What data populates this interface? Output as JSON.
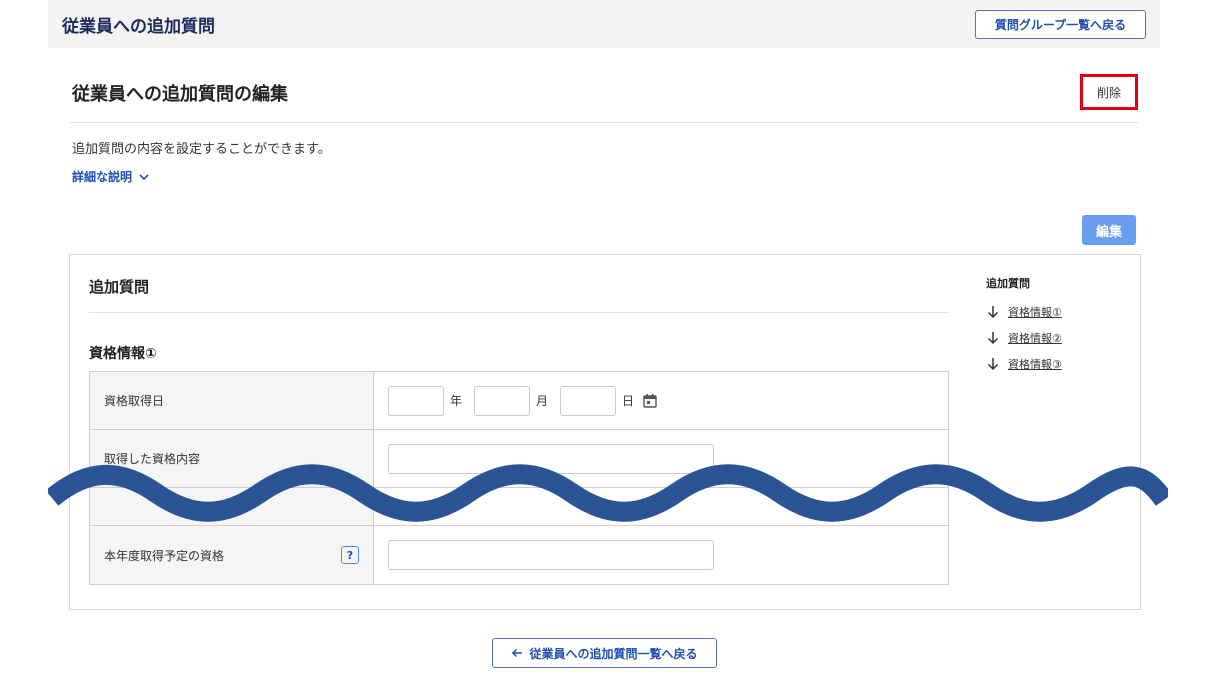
{
  "header": {
    "title": "従業員への追加質問",
    "back_groups_label": "質問グループ一覧へ戻る"
  },
  "page": {
    "title": "従業員への追加質問の編集",
    "delete_label": "削除",
    "description": "追加質問の内容を設定することができます。",
    "details_label": "詳細な説明",
    "edit_label": "編集"
  },
  "card": {
    "title": "追加質問",
    "section_title": "資格情報①",
    "rows": {
      "acquired_date_label": "資格取得日",
      "year_unit": "年",
      "month_unit": "月",
      "day_unit": "日",
      "acquired_content_label": "取得した資格内容",
      "planned_label": "本年度取得予定の資格",
      "help_glyph": "?"
    }
  },
  "toc": {
    "title": "追加質問",
    "items": [
      "資格情報①",
      "資格情報②",
      "資格情報③"
    ]
  },
  "footer": {
    "back_list_label": "従業員への追加質問一覧へ戻る"
  },
  "colors": {
    "accent": "#1f4fb0",
    "delete_highlight": "#e0000c",
    "wave": "#2b5494",
    "edit_button": "#6a9ded"
  },
  "icons": {
    "details": "chevron-down-icon",
    "calendar": "calendar-icon",
    "toc_item": "arrow-down-icon",
    "back": "arrow-left-icon"
  }
}
